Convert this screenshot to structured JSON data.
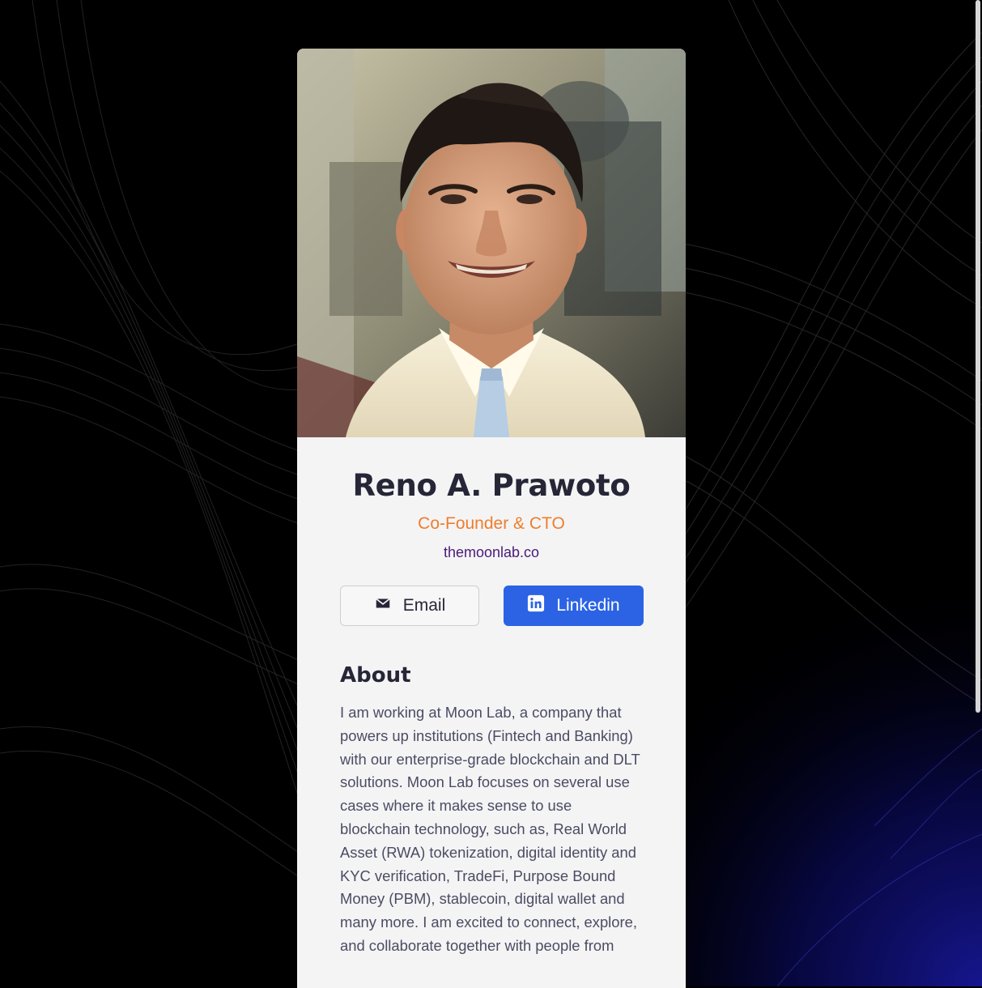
{
  "profile": {
    "name": "Reno A. Prawoto",
    "role": "Co-Founder & CTO",
    "website": "themoonlab.co",
    "photo_alt": "Reno A. Prawoto"
  },
  "actions": {
    "email_label": "Email",
    "email_icon": "envelope-icon",
    "linkedin_label": "Linkedin",
    "linkedin_icon": "linkedin-icon"
  },
  "about": {
    "title": "About",
    "text": "I am working at Moon Lab, a company that powers up institutions (Fintech and Banking) with our enterprise-grade blockchain and DLT solutions. Moon Lab focuses on several use cases where it makes sense to use blockchain technology, such as, Real World Asset (RWA) tokenization, digital identity and KYC verification, TradeFi, Purpose Bound Money (PBM), stablecoin, digital wallet and many more. I am excited to connect, explore, and collaborate together with people from"
  },
  "colors": {
    "accent_orange": "#ef7d2b",
    "link_purple": "#4a1a78",
    "linkedin_blue": "#2b63e4",
    "card_bg": "#f4f4f5",
    "page_bg": "#000000"
  }
}
